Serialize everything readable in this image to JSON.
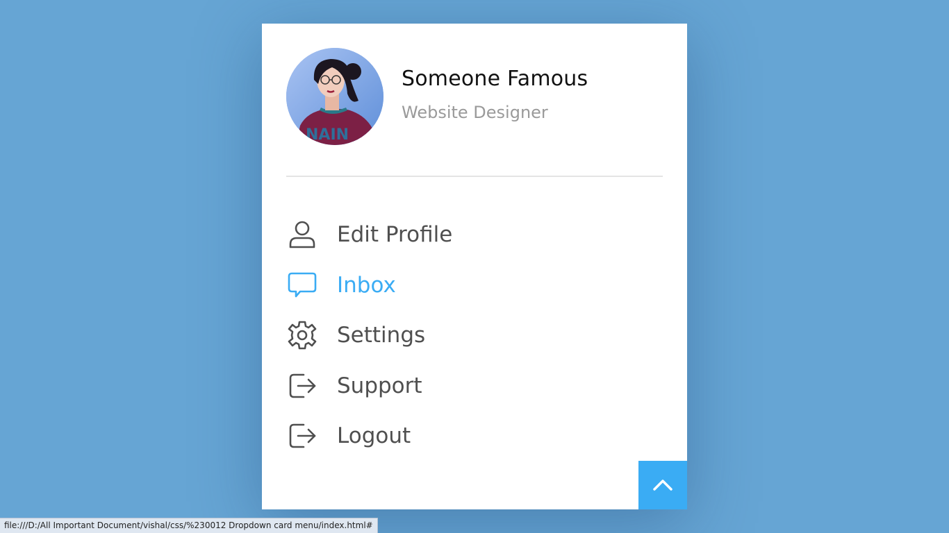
{
  "profile": {
    "name": "Someone Famous",
    "role": "Website Designer",
    "avatar_icon": "profile-photo"
  },
  "menu": {
    "items": [
      {
        "label": "Edit Profile",
        "icon": "user-icon",
        "active": false
      },
      {
        "label": "Inbox",
        "icon": "chat-bubble-icon",
        "active": true
      },
      {
        "label": "Settings",
        "icon": "gear-icon",
        "active": false
      },
      {
        "label": "Support",
        "icon": "sign-out-icon",
        "active": false
      },
      {
        "label": "Logout",
        "icon": "sign-out-icon",
        "active": false
      }
    ]
  },
  "collapse": {
    "icon": "chevron-up-icon"
  },
  "status_bar": {
    "url": "file:///D:/All Important Document/vishal/css/%230012 Dropdown card menu/index.html#"
  },
  "colors": {
    "background": "#66a5d4",
    "accent": "#3aacf4",
    "text": "#4f4f4f",
    "muted": "#9a9a9a"
  }
}
